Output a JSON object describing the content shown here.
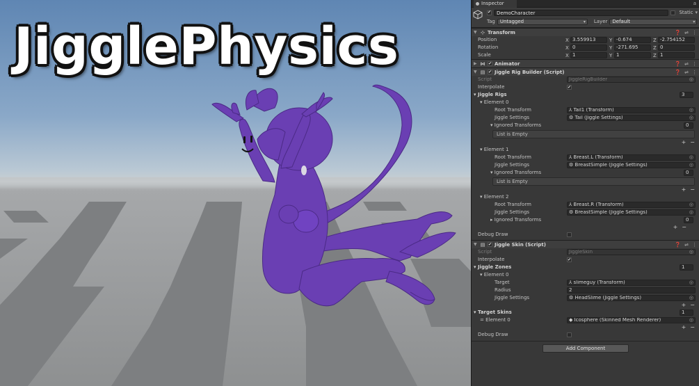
{
  "scene": {
    "title": "JigglePhysics"
  },
  "inspector": {
    "tab_label": "Inspector",
    "object": {
      "name": "DemoCharacter",
      "active": true,
      "static_label": "Static",
      "tag_label": "Tag",
      "tag_value": "Untagged",
      "layer_label": "Layer",
      "layer_value": "Default"
    },
    "transform": {
      "title": "Transform",
      "position_label": "Position",
      "rotation_label": "Rotation",
      "scale_label": "Scale",
      "position": {
        "x": "3.559913",
        "y": "-0.674",
        "z": "-2.754152"
      },
      "rotation": {
        "x": "0",
        "y": "-271.695",
        "z": "0"
      },
      "scale": {
        "x": "1",
        "y": "1",
        "z": "1"
      }
    },
    "animator": {
      "title": "Animator"
    },
    "rig_builder": {
      "title": "Jiggle Rig Builder (Script)",
      "script_label": "Script",
      "script_value": "JiggleRigBuilder",
      "interpolate_label": "Interpolate",
      "rigs_label": "Jiggle Rigs",
      "rigs_count": "3",
      "root_label": "Root Transform",
      "settings_label": "Jiggle Settings",
      "ignored_label": "Ignored Transforms",
      "empty_label": "List is Empty",
      "elements": [
        {
          "name": "Element 0",
          "root": "Tail1 (Transform)",
          "settings": "Tail (Jiggle Settings)",
          "ignored_count": "0"
        },
        {
          "name": "Element 1",
          "root": "Breast.L (Transform)",
          "settings": "BreastSimple (Jiggle Settings)",
          "ignored_count": "0"
        },
        {
          "name": "Element 2",
          "root": "Breast.R (Transform)",
          "settings": "BreastSimple (Jiggle Settings)",
          "ignored_count": "0"
        }
      ],
      "debug_label": "Debug Draw"
    },
    "skin": {
      "title": "Jiggle Skin (Script)",
      "script_label": "Script",
      "script_value": "JiggleSkin",
      "interpolate_label": "Interpolate",
      "zones_label": "Jiggle Zones",
      "zones_count": "1",
      "zone": {
        "name": "Element 0",
        "target_label": "Target",
        "target": "slimeguy (Transform)",
        "radius_label": "Radius",
        "radius": "2",
        "settings_label": "Jiggle Settings",
        "settings": "HeadSlime (Jiggle Settings)"
      },
      "target_skins_label": "Target Skins",
      "target_skins_count": "1",
      "skin_element": {
        "name": "Element 0",
        "value": "Icosphere (Skinned Mesh Renderer)"
      },
      "debug_label": "Debug Draw"
    },
    "add_component": "Add Component"
  }
}
